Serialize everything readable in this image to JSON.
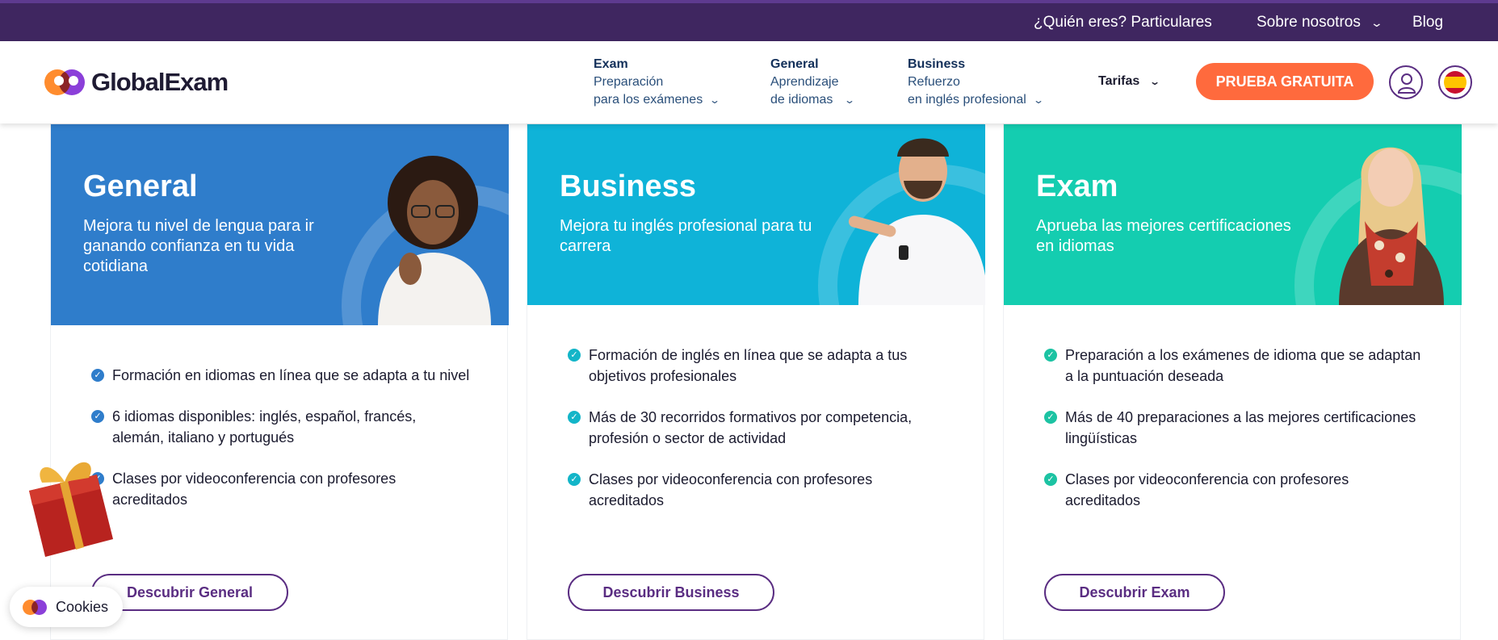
{
  "topbar": {
    "who": "¿Quién eres? Particulares",
    "about": "Sobre nosotros",
    "blog": "Blog"
  },
  "header": {
    "logo_text": "GlobalExam",
    "nav": [
      {
        "title": "Exam",
        "line1": "Preparación",
        "line2": "para los exámenes"
      },
      {
        "title": "General",
        "line1": "Aprendizaje",
        "line2": "de idiomas"
      },
      {
        "title": "Business",
        "line1": "Refuerzo",
        "line2": "en inglés profesional"
      }
    ],
    "tarifas": "Tarifas",
    "cta": "PRUEBA GRATUITA"
  },
  "cards": [
    {
      "title": "General",
      "desc": "Mejora tu nivel de lengua para ir ganando confianza en tu vida cotidiana",
      "color": "#2f7dcb",
      "check_color": "#2f7dcb",
      "features": [
        "Formación en idiomas en línea que se adapta a tu nivel",
        "6 idiomas disponibles: inglés, español, francés, alemán, italiano y portugués",
        "Clases por videoconferencia con profesores acreditados"
      ],
      "button": "Descubrir General"
    },
    {
      "title": "Business",
      "desc": "Mejora tu inglés profesional para tu carrera",
      "color": "#0fb3d8",
      "check_color": "#13b5c8",
      "features": [
        "Formación de inglés en línea que se adapta a tus objetivos profesionales",
        "Más de 30 recorridos formativos por competencia, profesión o sector de actividad",
        "Clases por videoconferencia con profesores acreditados"
      ],
      "button": "Descubrir Business"
    },
    {
      "title": "Exam",
      "desc": "Aprueba las mejores certificaciones en idiomas",
      "color": "#14cdb0",
      "check_color": "#1cc3a3",
      "features": [
        "Preparación a los exámenes de idioma que se adaptan a la puntuación deseada",
        "Más de 40 preparaciones a las mejores certificaciones lingüísticas",
        "Clases por videoconferencia con profesores acreditados"
      ],
      "button": "Descubrir Exam"
    }
  ],
  "cookies": {
    "label": "Cookies"
  },
  "icons": {
    "chevron": "chevron-down-icon",
    "check": "check-circle-icon",
    "user": "user-icon",
    "flag": "spain-flag-icon",
    "gift": "gift-icon"
  }
}
